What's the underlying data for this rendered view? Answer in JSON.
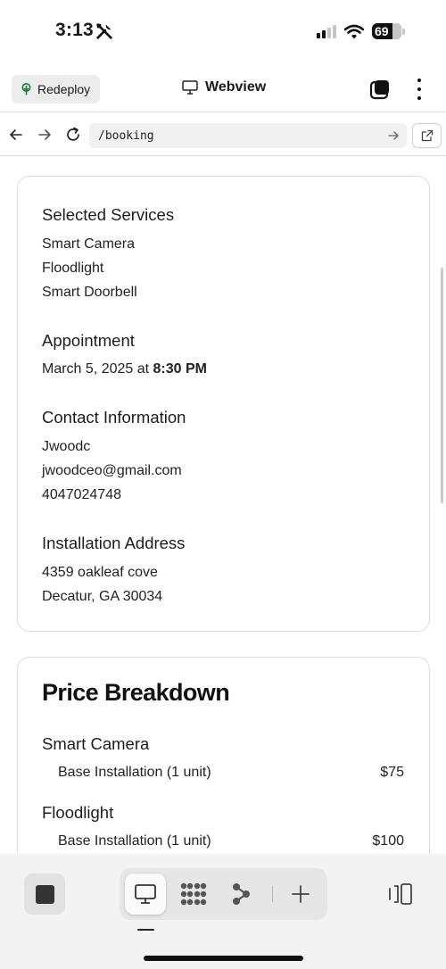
{
  "status_bar": {
    "time": "3:13",
    "battery": "69"
  },
  "app_header": {
    "redeploy_label": "Redeploy",
    "title": "Webview"
  },
  "url_bar": {
    "url": "/booking"
  },
  "booking": {
    "services": {
      "title": "Selected Services",
      "items": [
        "Smart Camera",
        "Floodlight",
        "Smart Doorbell"
      ]
    },
    "appointment": {
      "title": "Appointment",
      "date_prefix": "March 5, 2025 at ",
      "time": "8:30 PM"
    },
    "contact": {
      "title": "Contact Information",
      "name": "Jwoodc",
      "email": "jwoodceo@gmail.com",
      "phone": "4047024748"
    },
    "address": {
      "title": "Installation Address",
      "line1": "4359 oakleaf cove",
      "line2": "Decatur, GA 30034"
    }
  },
  "price_breakdown": {
    "title": "Price Breakdown",
    "groups": [
      {
        "name": "Smart Camera",
        "label": "Base Installation (1 unit)",
        "amount": "$75"
      },
      {
        "name": "Floodlight",
        "label": "Base Installation (1 unit)",
        "amount": "$100"
      }
    ]
  },
  "icons": {
    "status_tools": "tools-icon",
    "signal": "cellular-signal-icon",
    "wifi": "wifi-icon",
    "battery": "battery-icon",
    "redeploy": "sprout-icon",
    "webview": "monitor-icon",
    "tabs": "tabs-icon",
    "more": "more-vertical-icon",
    "back": "arrow-left-icon",
    "forward": "arrow-right-icon",
    "reload": "reload-icon",
    "go": "arrow-right-icon",
    "external": "external-link-icon",
    "stop": "stop-icon",
    "preview": "monitor-icon",
    "grid": "dots-grid-icon",
    "graph": "graph-nodes-icon",
    "add": "plus-icon",
    "panel": "side-panel-icon"
  },
  "colors": {
    "accent_green": "#1f7a3a",
    "card_border": "#dcdcdc",
    "toolbar_bg": "#f3f3f3"
  }
}
